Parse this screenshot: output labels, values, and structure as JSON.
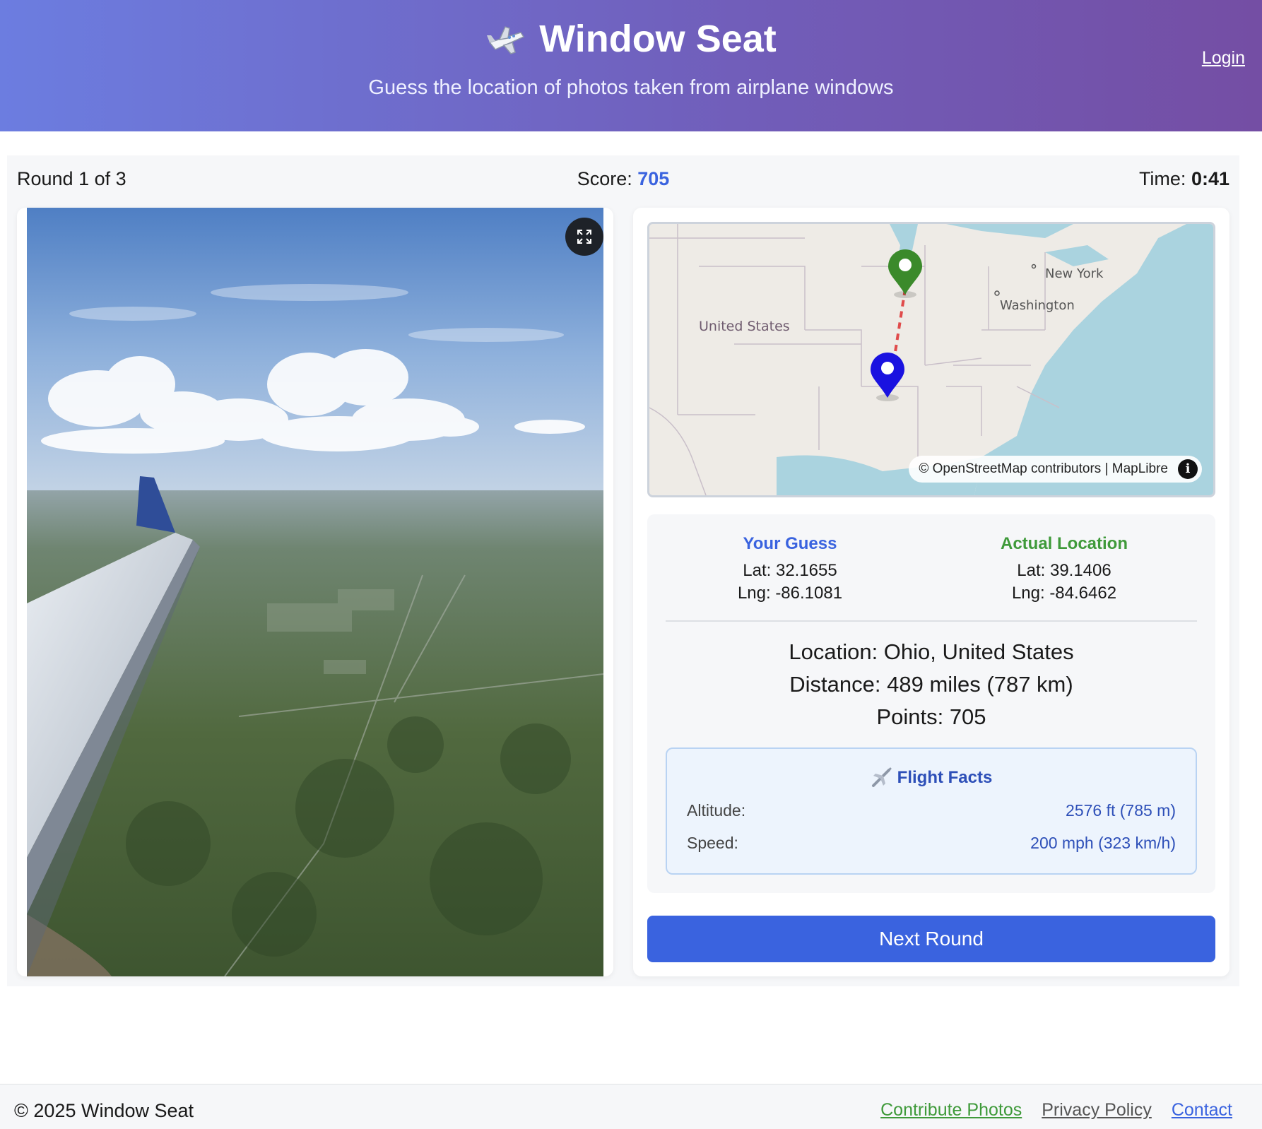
{
  "header": {
    "title": "Window Seat",
    "subtitle": "Guess the location of photos taken from airplane windows",
    "login": "Login"
  },
  "status": {
    "round": "Round 1 of 3",
    "score_label": "Score:",
    "score_value": "705",
    "time_label": "Time:",
    "time_value": "0:41"
  },
  "map": {
    "labels": {
      "country": "United States",
      "city1": "New York",
      "city2": "Washington"
    },
    "attribution": "© OpenStreetMap contributors | MapLibre",
    "info": "i"
  },
  "guess": {
    "heading": "Your Guess",
    "lat": "Lat: 32.1655",
    "lng": "Lng: -86.1081"
  },
  "actual": {
    "heading": "Actual Location",
    "lat": "Lat: 39.1406",
    "lng": "Lng: -84.6462"
  },
  "summary": {
    "location": "Location: Ohio, United States",
    "distance": "Distance: 489 miles (787 km)",
    "points": "Points: 705"
  },
  "facts": {
    "title": "Flight Facts",
    "altitude_label": "Altitude:",
    "altitude_value": "2576 ft (785 m)",
    "speed_label": "Speed:",
    "speed_value": "200 mph (323 km/h)"
  },
  "next_button": "Next Round",
  "footer": {
    "copyright": "© 2025 Window Seat",
    "links": [
      "Contribute Photos",
      "Privacy Policy",
      "Contact"
    ]
  },
  "colors": {
    "accent": "#3a63df",
    "actual": "#3f9a3a",
    "header_start": "#6c7de0",
    "header_end": "#744ea4"
  },
  "icons": [
    "airplane-icon",
    "expand-icon",
    "info-icon",
    "guess-pin-icon",
    "actual-pin-icon"
  ]
}
